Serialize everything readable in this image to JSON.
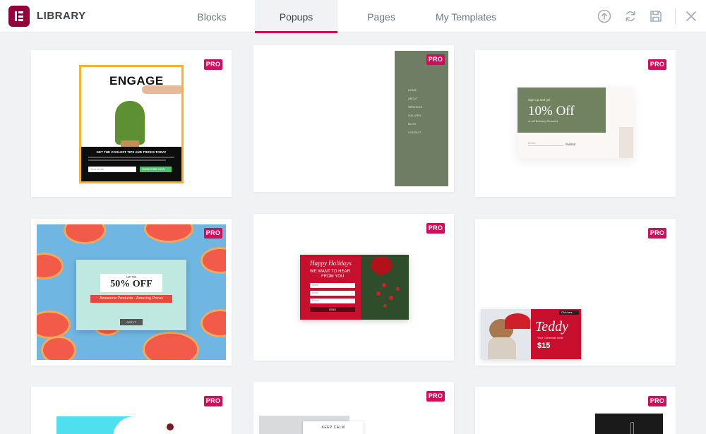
{
  "header": {
    "title": "LIBRARY",
    "tabs": [
      {
        "label": "Blocks"
      },
      {
        "label": "Popups"
      },
      {
        "label": "Pages"
      },
      {
        "label": "My Templates"
      }
    ],
    "active_tab": "Popups",
    "icons": [
      "upload-icon",
      "sync-icon",
      "save-icon",
      "close-icon"
    ]
  },
  "badge_label": "PRO",
  "templates": [
    {
      "headline": "ENGAGE",
      "caption": "GET THE COOLEST TIPS AND TRICKS TODAY",
      "input_placeholder": "Your email",
      "button_label": "SUBSCRIBE NOW"
    },
    {
      "menu_items": [
        "HOME",
        "ABOUT",
        "SERVICES",
        "GALLERY",
        "BLOG",
        "CONTACT"
      ]
    },
    {
      "kicker": "Sign up and get",
      "headline": "10% Off",
      "subline": "on all Birthday Rewards",
      "input_placeholder": "Email",
      "button_label": "Submit"
    },
    {
      "kicker": "UP TO",
      "headline": "50% OFF",
      "ribbon": "Awesome Products - Amazing Prices",
      "button_label": "GOT IT"
    },
    {
      "script_title": "Happy Holidays",
      "headline_line1": "WE WANT TO HEAR",
      "headline_line2": "FROM YOU",
      "fields": [
        "Name",
        "Email",
        "Phone"
      ],
      "button_label": "SEND"
    },
    {
      "script_title": "Teddy",
      "subline": "Your Christmas Bear",
      "price": "$15",
      "link_label": "Click here"
    },
    {},
    {
      "headline": "KEEP CALM"
    },
    {}
  ],
  "colors": {
    "brand": "#93003c",
    "accent": "#d30c5c",
    "background": "#f1f2f3"
  }
}
